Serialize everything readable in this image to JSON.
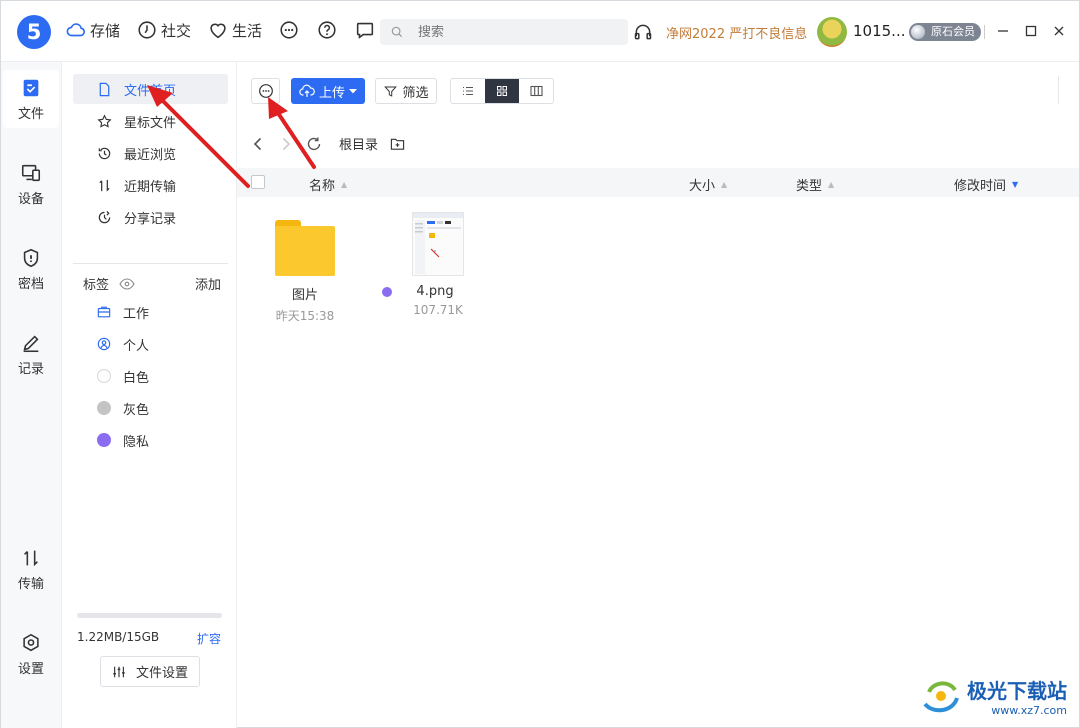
{
  "titlebar": {
    "logo": "5",
    "nav": [
      {
        "label": "存储",
        "icon": "cloud-icon"
      },
      {
        "label": "社交",
        "icon": "clock-icon"
      },
      {
        "label": "生活",
        "icon": "heart-icon"
      }
    ],
    "search_placeholder": "搜索",
    "promo": "净网2022 严打不良信息",
    "username": "1015...",
    "vip_label": "原石会员"
  },
  "rail": [
    {
      "label": "文件",
      "icon": "file-icon",
      "active": true
    },
    {
      "label": "设备",
      "icon": "devices-icon"
    },
    {
      "label": "密档",
      "icon": "shield-icon"
    },
    {
      "label": "记录",
      "icon": "pen-icon"
    },
    {
      "label": "传输",
      "icon": "transfer-icon"
    },
    {
      "label": "设置",
      "icon": "settings-icon"
    }
  ],
  "panel": {
    "items": [
      {
        "label": "文件首页",
        "icon": "document-icon",
        "active": true
      },
      {
        "label": "星标文件",
        "icon": "star-icon"
      },
      {
        "label": "最近浏览",
        "icon": "history-icon"
      },
      {
        "label": "近期传输",
        "icon": "transfer-icon"
      },
      {
        "label": "分享记录",
        "icon": "share-record-icon"
      }
    ],
    "tags_label": "标签",
    "add_label": "添加",
    "tags": [
      {
        "label": "工作",
        "icon": "briefcase-icon"
      },
      {
        "label": "个人",
        "icon": "person-icon"
      },
      {
        "label": "白色",
        "color": "#ffffff"
      },
      {
        "label": "灰色",
        "color": "#c4c4c4"
      },
      {
        "label": "隐私",
        "color": "#8a6cf0"
      }
    ],
    "storage_text": "1.22MB/15GB",
    "storage_used_fraction": 0.0001,
    "expand_label": "扩容",
    "file_settings_label": "文件设置"
  },
  "toolbar": {
    "upload_label": "上传",
    "filter_label": "筛选"
  },
  "path": {
    "root_label": "根目录"
  },
  "columns": {
    "name": "名称",
    "size": "大小",
    "type": "类型",
    "modified": "修改时间"
  },
  "files": [
    {
      "name": "图片",
      "meta": "昨天15:38",
      "kind": "folder"
    },
    {
      "name": "4.png",
      "meta": "107.71K",
      "kind": "image",
      "tag_color": "#8a6cf0"
    }
  ],
  "watermark": {
    "title": "极光下载站",
    "url": "www.xz7.com"
  },
  "colors": {
    "accent": "#2d6bf2",
    "annotation_arrow": "#e02020"
  }
}
